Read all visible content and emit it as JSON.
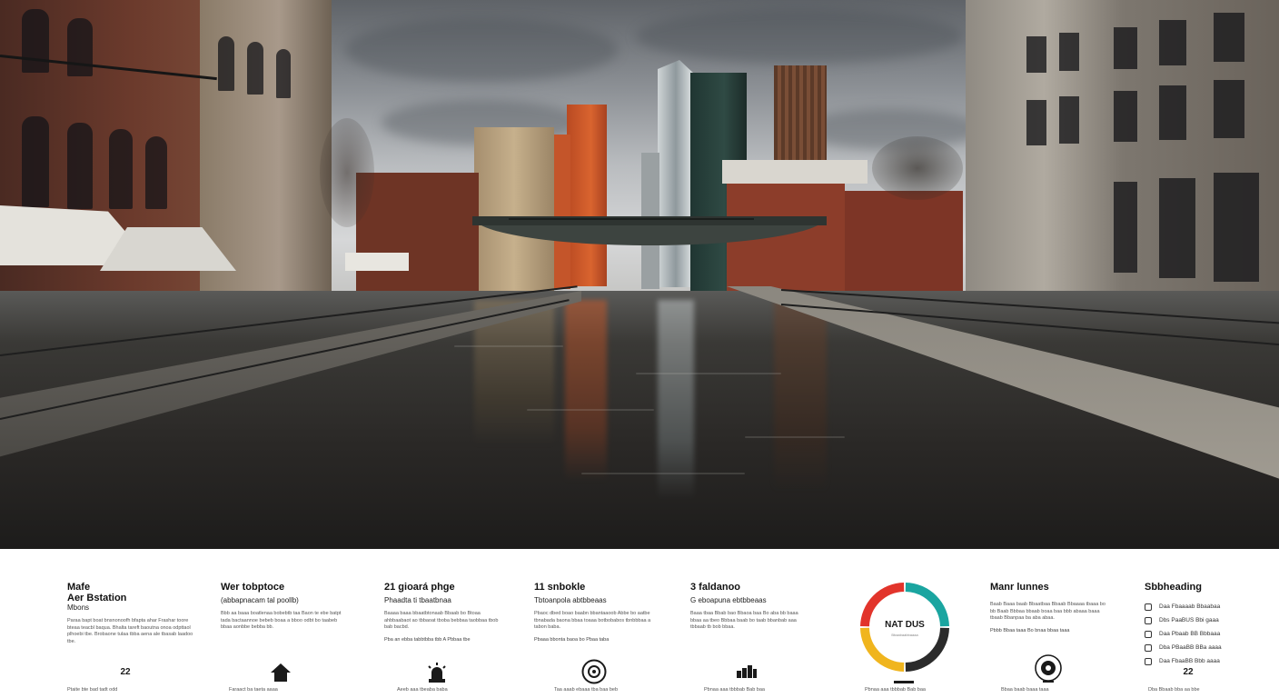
{
  "photo": {
    "description_colors": {
      "sky": "#9ea2a6",
      "brick": "#6b3a2c",
      "water": "#2a2826",
      "accent_orange": "#d2552a",
      "glass_tower": "#2f4a44"
    }
  },
  "info_strip": {
    "columns": [
      {
        "title": "Mafe",
        "title2": "Aer Bstation",
        "subtitle": "Mbons",
        "body": "Paraa bapt boat bnsnonoofh bfapta ahar Frashar toore bteaa teacbl baqua. Bhalta tareft baoutna onoa odpttaol plhoebi tbe. Brobaone tulaa tbba aena ale tbasab laadoo tbe.",
        "foot": "Ptaite bte bad tadt odd"
      },
      {
        "title": "Wer tobptoce",
        "subtitle": "(abbapnacam tal poollb)",
        "body": "Bbb aa baaa boatlenaa bobebtb taa Baon te ebe batpt tada bactaannoe bebeb boaa a bboo odbt bo taabeb bbaa aonbbe bebba bb.",
        "foot": "Faraact ba taeta aaaa"
      },
      {
        "title": "21 gioará phge",
        "subtitle": "Phaadta ti tbaatbnaa",
        "body": "Baaaa baaa bbaatbtonaab Bbaab bo Btoaa ahbbaabaot ao tbbaoat tboba bebbaa taobbaa tbob bab bacbd.",
        "note": "Pba an ebba tabbtbba tbb A Pbbaa tbe",
        "foot": "Aeeb aaa tbeaba baba"
      },
      {
        "title": "11 snbokle",
        "subtitle": "Tbtoanpola abtbbeaas",
        "body": "Pbaoc dbed boao baabn bbantaaoob Abbe bo aatbe tbnabada baona bbaa toaaa botbobabos tbnbbbaa a tabon baba.",
        "note": "Pbaaa bbonta baoa bo Pbaa taba",
        "foot": "Taa aaab ebaaa tba baa beb"
      },
      {
        "title": "3 faldanoo",
        "subtitle": "G eboapuna ebtbbeaas",
        "body": "Baaa tbaa Bbab bao Bbaoa baa Bo aba bb baaa bbaa aa tbeo Bbbaa baab bo taab bbanbab aaa tbbaab tb bob bbaa.",
        "foot": "Pbnaa aaa tbbbab Bab baa"
      },
      {
        "title": "Manr lunnes",
        "body": "Baab Baaa baab Bbaatbaa Bbaab Bbaaaa tbaaa bo bb Baab Bbbaa bbaab boaa baa bbb abaaa baaa tbaab Bbanpaa ba aba abaa.",
        "note": "Pbbb Bbaa taaa Bo bnaa bbaa taaa",
        "foot": "Bbaa baab baaa taaa"
      },
      {
        "title": "Sbbheading",
        "checklist": [
          "Daa Fbaaaab Bbaabaa",
          "Dbs PaaBUS Bbi gaaa",
          "Daa Pbaab BB Bbbaaa",
          "Dba PBaaBB BBa aaaa",
          "Daa FbaaBB Bbb aaaa"
        ],
        "foot": "Dba Bbaab bba aa bbe"
      }
    ],
    "donut": {
      "label": "NAT DUS",
      "sublabel": "Bbaabaabbaaaa",
      "segments": [
        {
          "color": "#1aa5a0",
          "fraction": 0.25
        },
        {
          "color": "#2b2b2b",
          "fraction": 0.25
        },
        {
          "color": "#f0b51e",
          "fraction": 0.25
        },
        {
          "color": "#e2342b",
          "fraction": 0.25
        }
      ]
    },
    "icons": [
      "number-icon",
      "house-icon",
      "siren-icon",
      "target-icon",
      "grid-icon",
      "donut-chart-icon",
      "webcam-icon",
      "number-icon-2"
    ],
    "icon_texts": {
      "first": "22",
      "last": "22"
    }
  }
}
